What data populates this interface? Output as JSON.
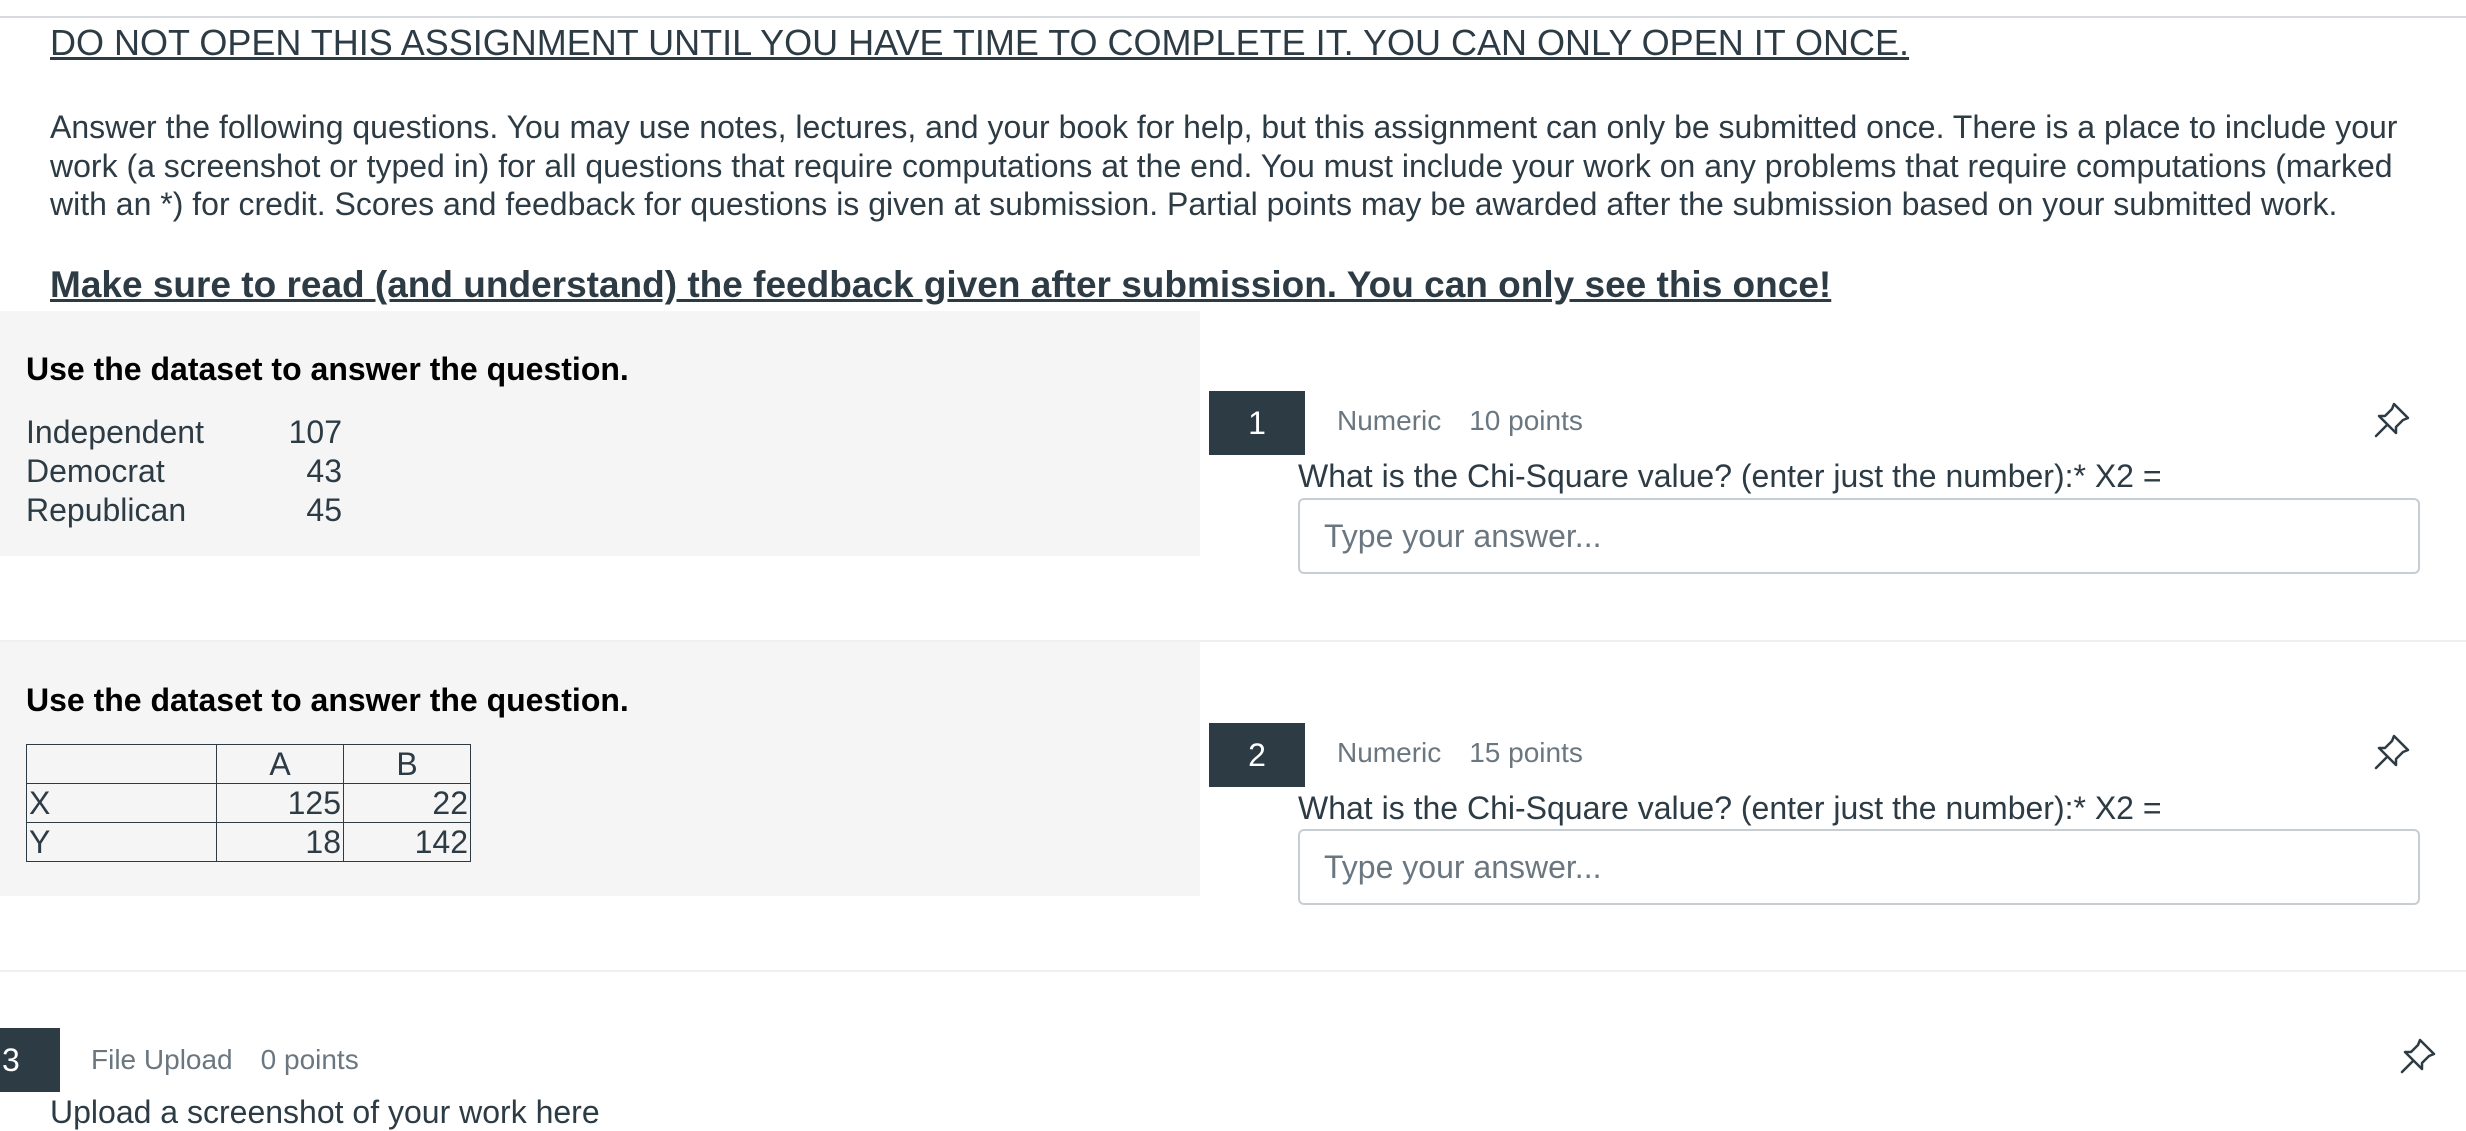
{
  "header": {
    "warning": "DO NOT OPEN THIS ASSIGNMENT UNTIL YOU HAVE TIME TO COMPLETE IT. YOU CAN ONLY OPEN IT ONCE.",
    "intro": "Answer the following questions. You may use notes, lectures, and your book for help, but this assignment can only be submitted once. There is a place to include your work (a screenshot or typed in) for all questions that require computations at the end. You must include your work on any problems that require computations (marked with an *) for credit. Scores and feedback for questions is given at submission. Partial points may be awarded after the submission based on your submitted work.",
    "feedback_notice": "Make sure to read (and understand) the feedback given after submission. You can only see this once!"
  },
  "stimulus1": {
    "title": "Use the dataset to answer the question.",
    "rows": [
      {
        "label": "Independent",
        "value": "107"
      },
      {
        "label": "Democrat",
        "value": "43"
      },
      {
        "label": "Republican",
        "value": "45"
      }
    ]
  },
  "stimulus2": {
    "title": "Use the dataset to answer the question.",
    "table": {
      "header": [
        "",
        "A",
        "B"
      ],
      "rows": [
        [
          "X",
          "125",
          "22"
        ],
        [
          "Y",
          "18",
          "142"
        ]
      ]
    }
  },
  "questions": [
    {
      "number": "1",
      "type": "Numeric",
      "points": "10 points",
      "text": "What is the Chi-Square value? (enter just the number):* X2 =",
      "placeholder": "Type your answer...",
      "value": ""
    },
    {
      "number": "2",
      "type": "Numeric",
      "points": "15 points",
      "text": "What is the Chi-Square value? (enter just the number):* X2 =",
      "placeholder": "Type your answer...",
      "value": ""
    },
    {
      "number": "3",
      "type": "File Upload",
      "points": "0 points",
      "text": "Upload a screenshot of your work here"
    }
  ],
  "icons": {
    "pin": "pin-icon"
  },
  "colors": {
    "text": "#2d3b45",
    "muted": "#6b7780",
    "badge": "#2d3b45",
    "stimulus_bg": "#f5f5f5"
  }
}
